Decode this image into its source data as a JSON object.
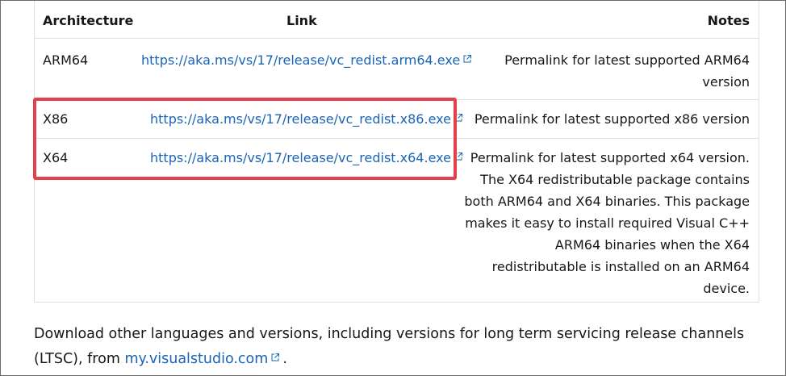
{
  "table": {
    "headers": {
      "architecture": "Architecture",
      "link": "Link",
      "notes": "Notes"
    },
    "rows": [
      {
        "architecture": "ARM64",
        "link": "https://aka.ms/vs/17/release/vc_redist.arm64.exe",
        "notes": [
          "Permalink for latest supported ARM64",
          "version"
        ]
      },
      {
        "architecture": "X86",
        "link": "https://aka.ms/vs/17/release/vc_redist.x86.exe",
        "notes": [
          "Permalink for latest supported x86 version"
        ]
      },
      {
        "architecture": "X64",
        "link": "https://aka.ms/vs/17/release/vc_redist.x64.exe",
        "notes": [
          "Permalink for latest supported x64 version.",
          "The X64 redistributable package contains",
          "both ARM64 and X64 binaries. This package",
          "makes it easy to install required Visual C++",
          "ARM64 binaries when the X64",
          "redistributable is installed on an ARM64",
          "device."
        ]
      }
    ]
  },
  "footer": {
    "line1": "Download other languages and versions, including versions for long term servicing release channels",
    "line2_prefix": "(LTSC), from ",
    "link_text": "my.visualstudio.com",
    "line2_suffix": "."
  },
  "colors": {
    "link": "#1a64b7",
    "highlight": "#e4404a",
    "border": "#e1e1e1"
  },
  "icons": {
    "external_link": "external-link-icon"
  }
}
